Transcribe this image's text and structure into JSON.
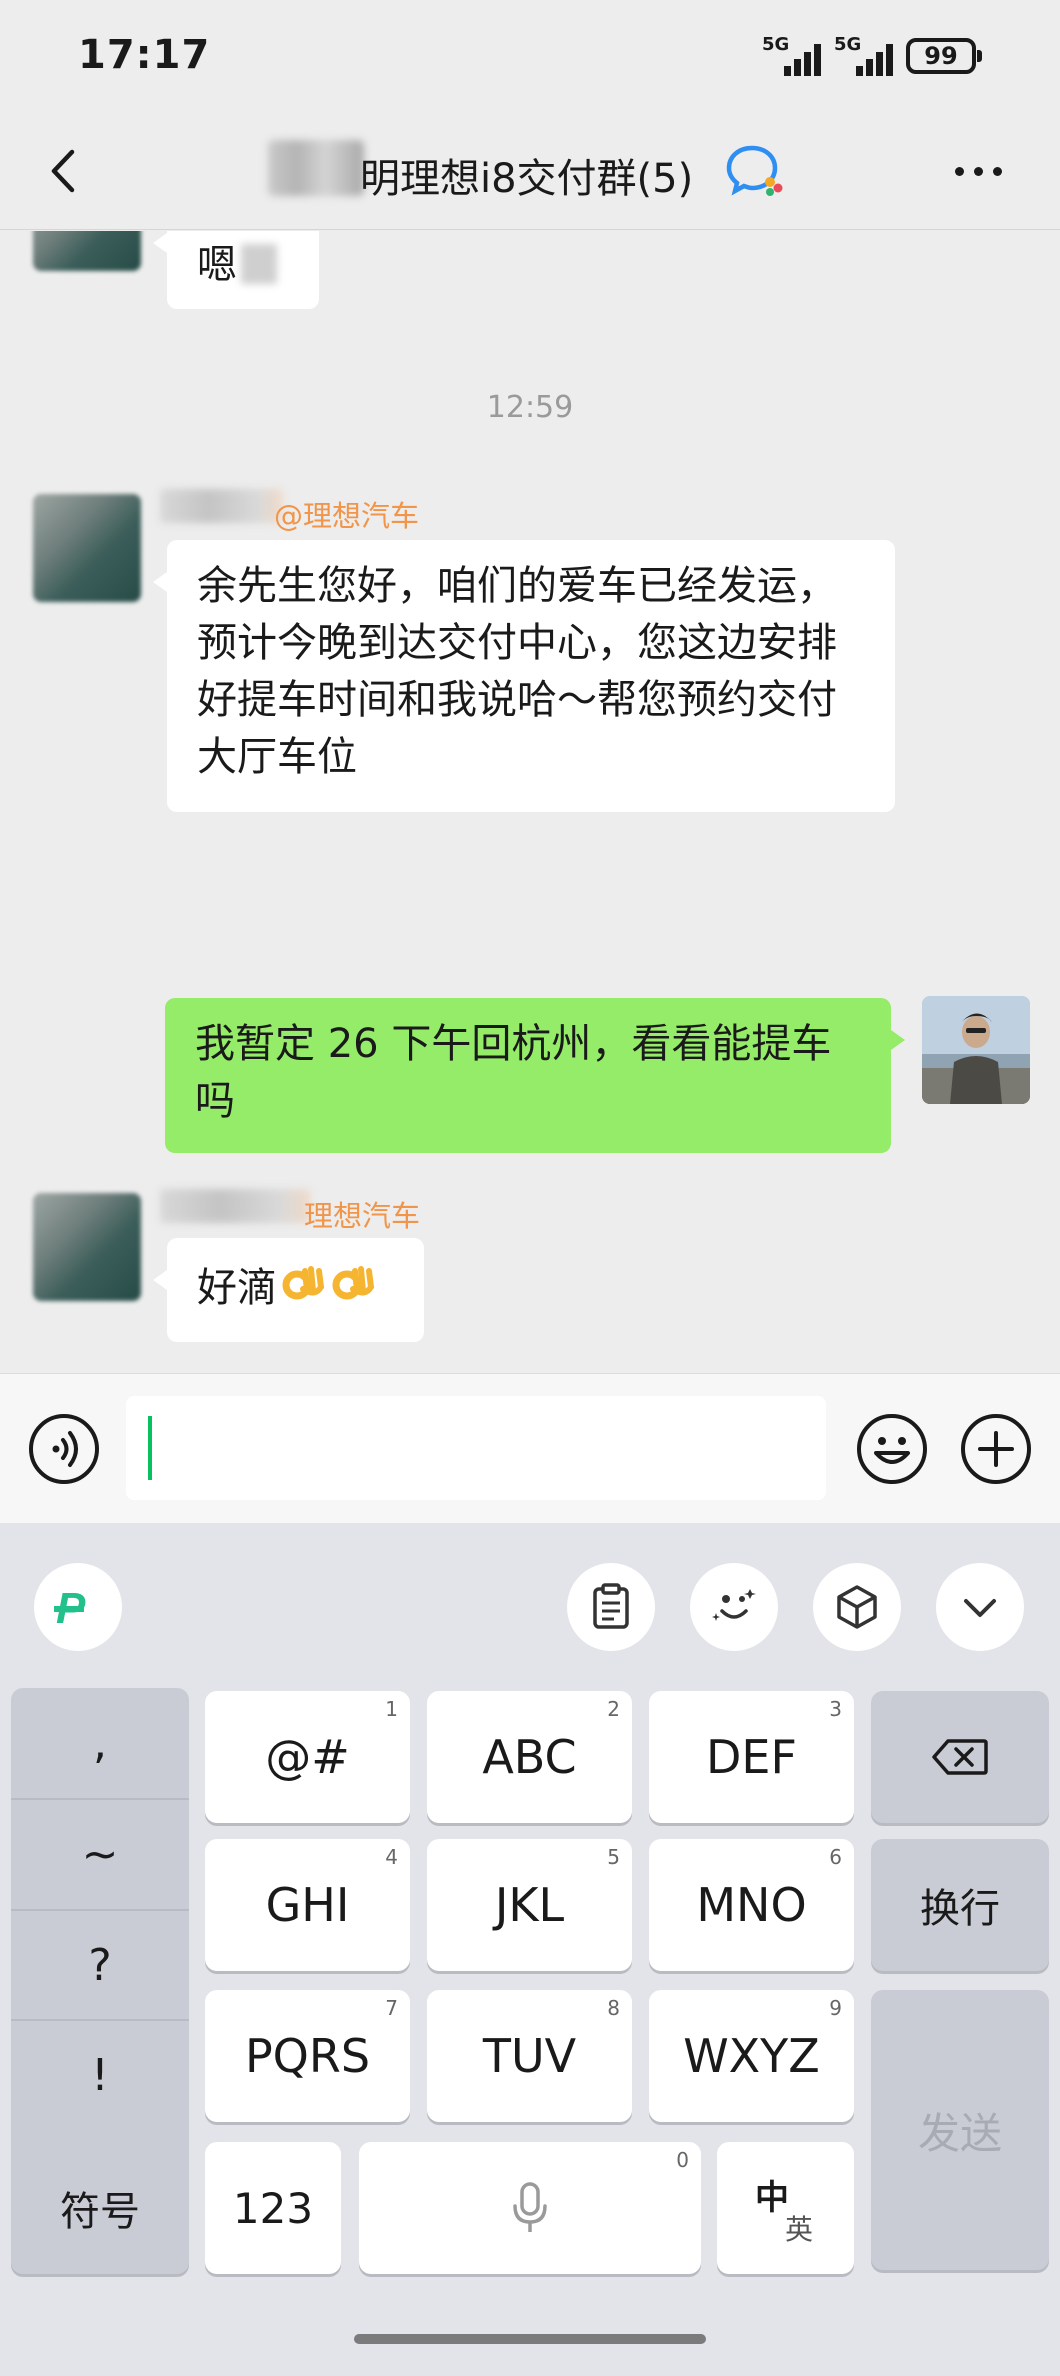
{
  "status": {
    "time": "17:17",
    "signal1": "5G",
    "signal2": "5G",
    "battery": "99"
  },
  "header": {
    "title": "明理想i8交付群(5)",
    "back_icon": "back-chevron-icon",
    "work_icon": "wecom-chat-icon",
    "more_icon": "more-dots-icon"
  },
  "messages": {
    "prev_text": "嗯",
    "time_sep": "12:59",
    "m1_sender": "@理想汽车",
    "m1_text": "余先生您好，咱们的爱车已经发运，预计今晚到达交付中心，您这边安排好提车时间和我说哈～帮您预约交付大厅车位",
    "m2_text": "我暂定 26 下午回杭州，看看能提车吗",
    "m3_sender": "理想汽车",
    "m3_text": "好滴"
  },
  "input": {
    "value": ""
  },
  "keyboard": {
    "punct": [
      ",",
      "~",
      "?",
      "!"
    ],
    "rows": [
      {
        "label": "@#",
        "num": "1"
      },
      {
        "label": "ABC",
        "num": "2"
      },
      {
        "label": "DEF",
        "num": "3"
      },
      {
        "label": "GHI",
        "num": "4"
      },
      {
        "label": "JKL",
        "num": "5"
      },
      {
        "label": "MNO",
        "num": "6"
      },
      {
        "label": "PQRS",
        "num": "7"
      },
      {
        "label": "TUV",
        "num": "8"
      },
      {
        "label": "WXYZ",
        "num": "9"
      }
    ],
    "enter": "换行",
    "send": "发送",
    "symbols": "符号",
    "numbers": "123",
    "space_num": "0",
    "lang_main": "中",
    "lang_sub": "英"
  },
  "colors": {
    "accent_green": "#07c160",
    "bubble_out": "#95ec69",
    "sender_name": "#f0954a"
  }
}
